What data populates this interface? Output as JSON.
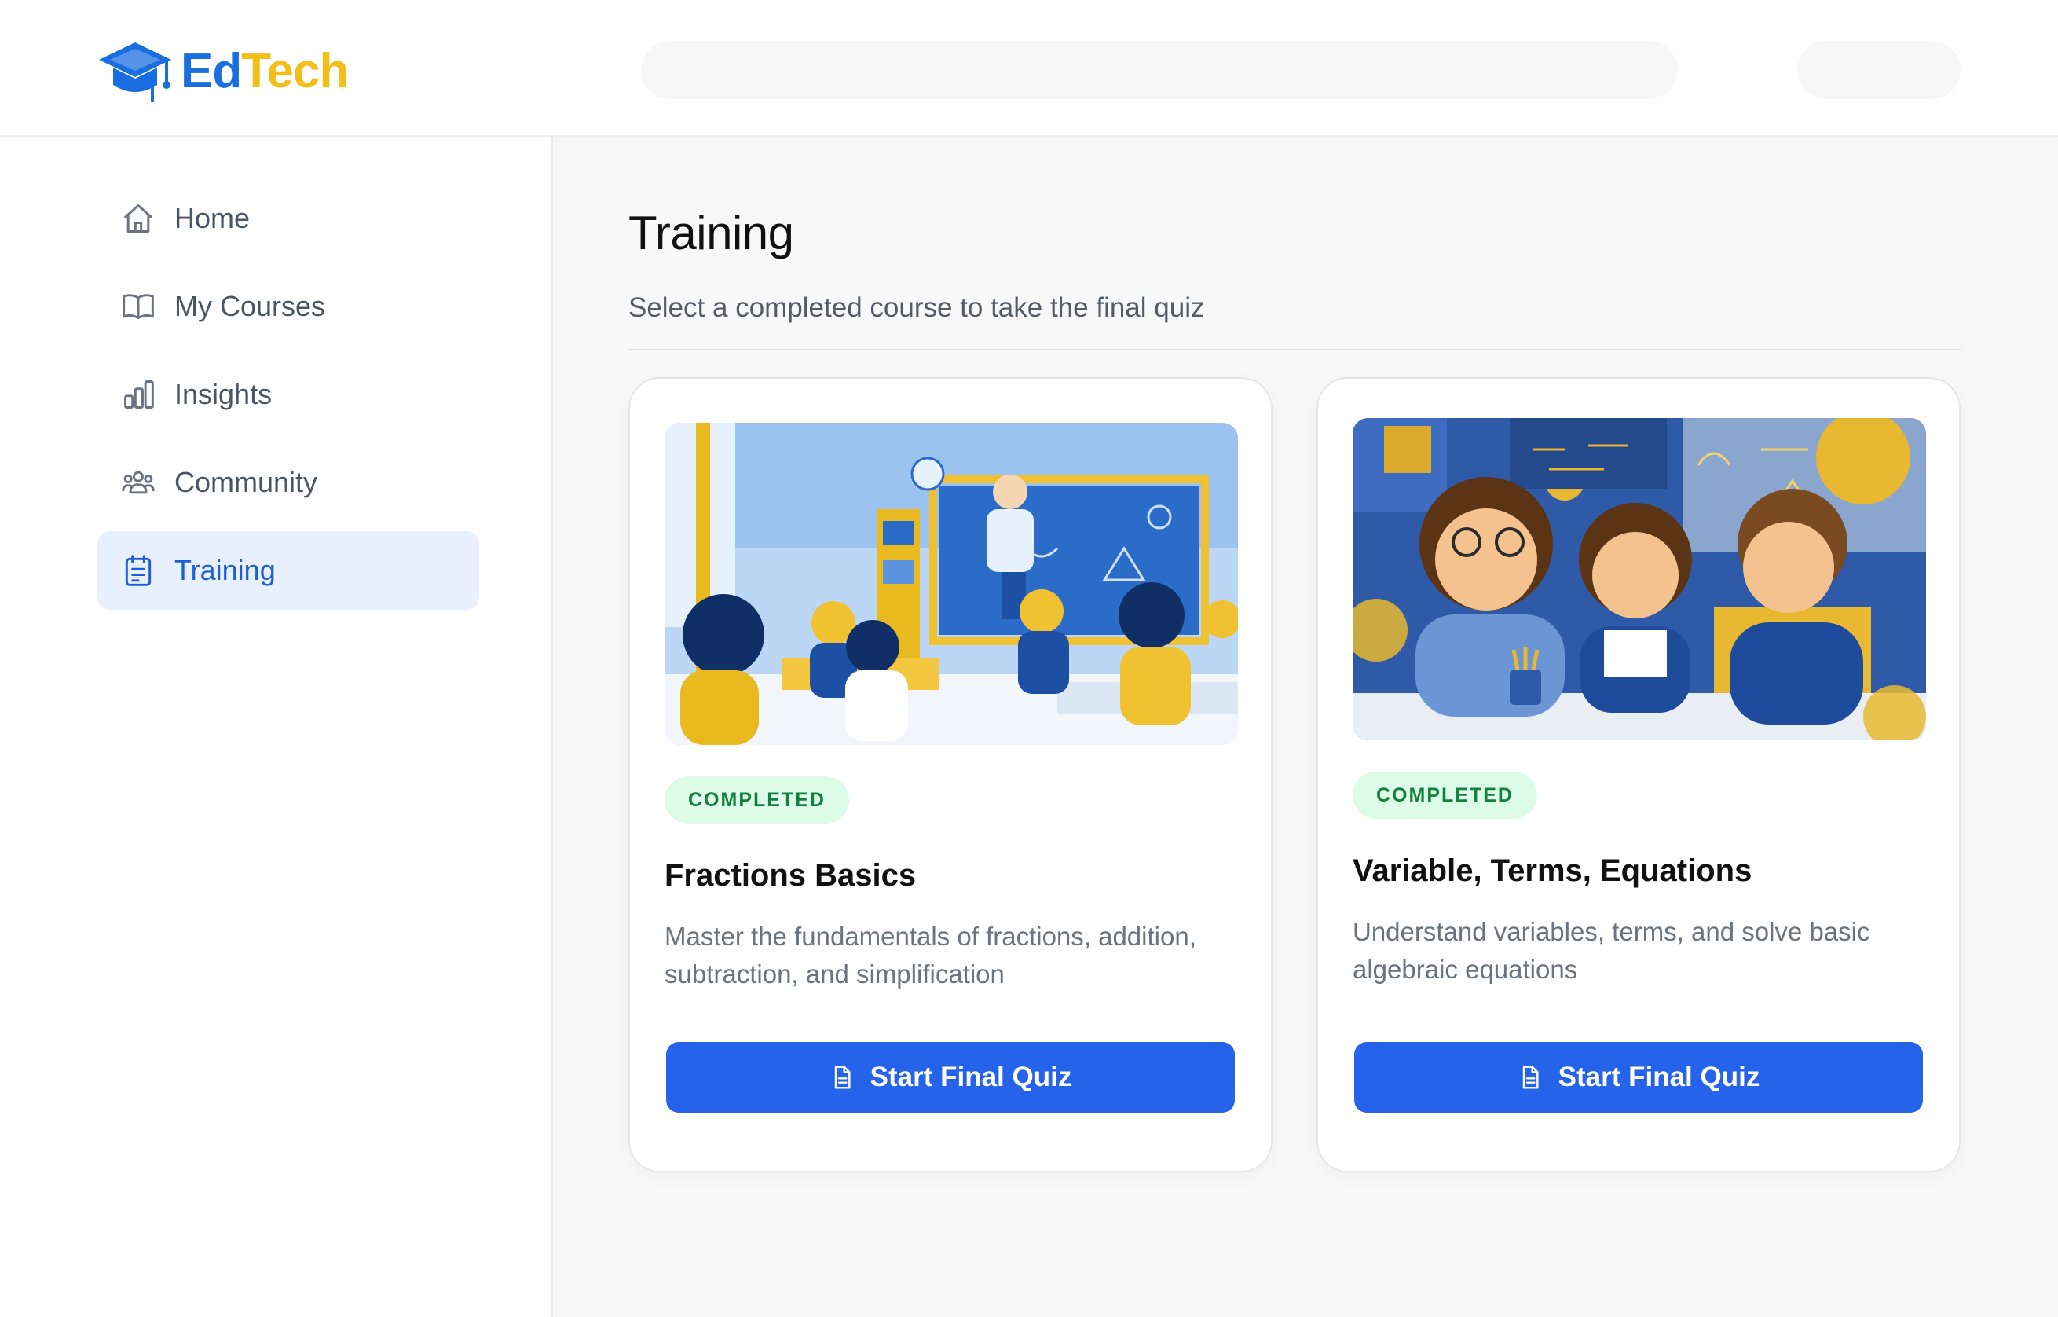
{
  "app": {
    "logo_part1": "Ed",
    "logo_part2": "Tech",
    "brand_colors": {
      "ed": "#1a6fe0",
      "tech": "#f4be19"
    }
  },
  "header": {
    "search_placeholder": "",
    "logo_icon": "graduation-cap-icon"
  },
  "sidebar": {
    "items": [
      {
        "label": "Home",
        "icon": "home-icon",
        "active": false
      },
      {
        "label": "My Courses",
        "icon": "book-open-icon",
        "active": false
      },
      {
        "label": "Insights",
        "icon": "bar-chart-icon",
        "active": false
      },
      {
        "label": "Community",
        "icon": "users-icon",
        "active": false
      },
      {
        "label": "Training",
        "icon": "clipboard-list-icon",
        "active": true
      }
    ],
    "active_color": "#1f5fd6"
  },
  "main": {
    "title": "Training",
    "subtitle": "Select a completed course to take the final quiz",
    "courses": [
      {
        "status": "COMPLETED",
        "title": "Fractions Basics",
        "description": "Master the fundamentals of fractions, addition, subtraction, and simplification",
        "button_label": "Start Final Quiz",
        "button_icon": "document-icon",
        "image": "classroom-illustration"
      },
      {
        "status": "COMPLETED",
        "title": "Variable, Terms, Equations",
        "description": "Understand variables, terms, and solve basic algebraic equations",
        "button_label": "Start Final Quiz",
        "button_icon": "document-icon",
        "image": "students-math-illustration"
      }
    ],
    "accent_color": "#2563eb",
    "badge_color": "#15803d"
  }
}
